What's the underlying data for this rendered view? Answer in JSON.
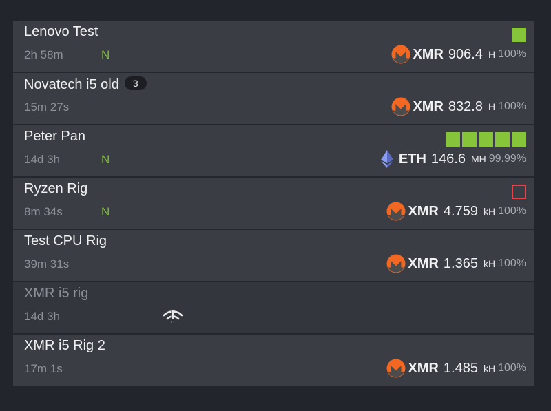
{
  "colors": {
    "background": "#22252b",
    "row": "#3a3d44",
    "ok_square": "#86c43a",
    "error_square": "#e0474c",
    "flag_n": "#7fbe38",
    "xmr_orange": "#f26822",
    "eth_blue": "#7b8bd8"
  },
  "rigs": [
    {
      "name": "Lenovo Test",
      "uptime": "2h 58m",
      "flag": "N",
      "coin": "XMR",
      "coin_icon": "monero-icon",
      "rate": "906.4",
      "unit": "H",
      "pct": "100%",
      "gpu_status": [
        "ok"
      ]
    },
    {
      "name": "Novatech i5 old",
      "badge": "3",
      "uptime": "15m 27s",
      "coin": "XMR",
      "coin_icon": "monero-icon",
      "rate": "832.8",
      "unit": "H",
      "pct": "100%"
    },
    {
      "name": "Peter Pan",
      "uptime": "14d 3h",
      "flag": "N",
      "coin": "ETH",
      "coin_icon": "ethereum-icon",
      "rate": "146.6",
      "unit": "MH",
      "pct": "99.99%",
      "gpu_status": [
        "ok",
        "ok",
        "ok",
        "ok",
        "ok"
      ]
    },
    {
      "name": "Ryzen Rig",
      "uptime": "8m 34s",
      "flag": "N",
      "coin": "XMR",
      "coin_icon": "monero-icon",
      "rate": "4.759",
      "unit": "kH",
      "pct": "100%",
      "gpu_status": [
        "error"
      ]
    },
    {
      "name": "Test CPU Rig",
      "uptime": "39m 31s",
      "coin": "XMR",
      "coin_icon": "monero-icon",
      "rate": "1.365",
      "unit": "kH",
      "pct": "100%"
    },
    {
      "name": "XMR i5 rig",
      "uptime": "14d 3h",
      "offline": true,
      "status_icon": "wifi-off-icon"
    },
    {
      "name": "XMR i5 Rig 2",
      "uptime": "17m 1s",
      "coin": "XMR",
      "coin_icon": "monero-icon",
      "rate": "1.485",
      "unit": "kH",
      "pct": "100%"
    }
  ]
}
